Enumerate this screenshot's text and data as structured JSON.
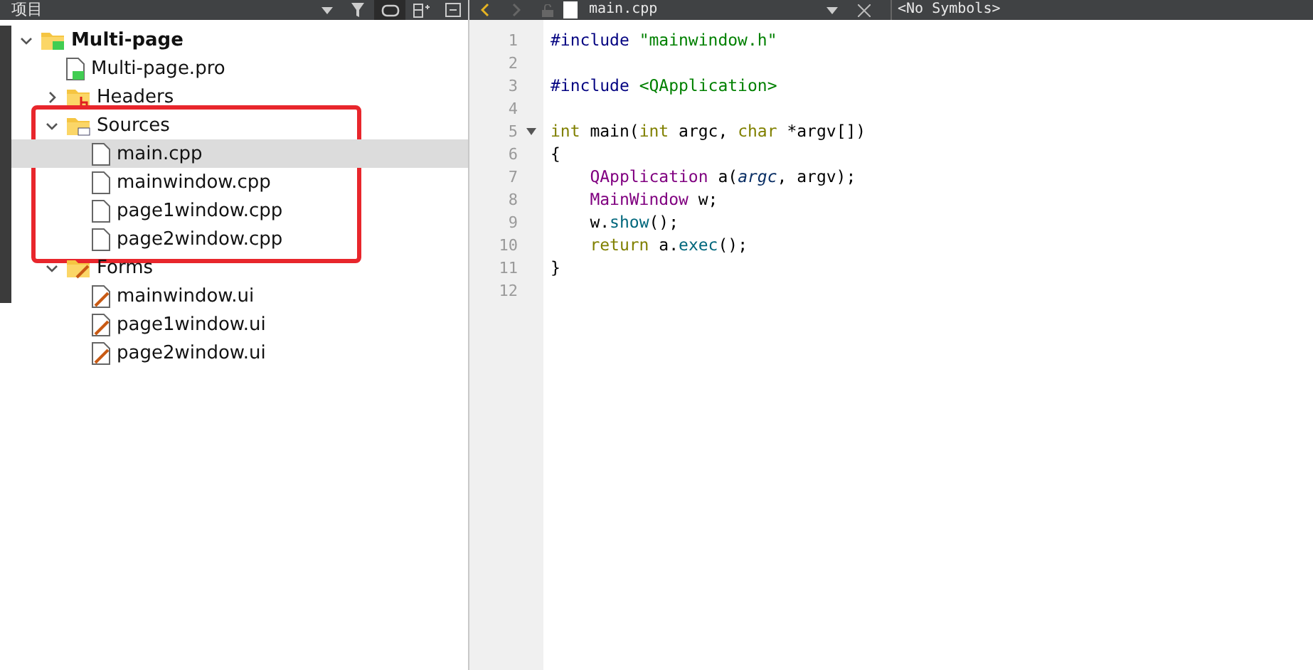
{
  "project_pane": {
    "title": "项目",
    "tree": [
      {
        "label": "Multi-page",
        "kind": "project",
        "expanded": true,
        "selected": false,
        "children": [
          {
            "label": "Multi-page.pro",
            "kind": "pro",
            "selected": false
          },
          {
            "label": "Headers",
            "kind": "folder-h",
            "expanded": false,
            "selected": false
          },
          {
            "label": "Sources",
            "kind": "folder-cpp",
            "expanded": true,
            "selected": false,
            "highlighted": true,
            "children": [
              {
                "label": "main.cpp",
                "kind": "file",
                "selected": true
              },
              {
                "label": "mainwindow.cpp",
                "kind": "file",
                "selected": false
              },
              {
                "label": "page1window.cpp",
                "kind": "file",
                "selected": false
              },
              {
                "label": "page2window.cpp",
                "kind": "file",
                "selected": false
              }
            ]
          },
          {
            "label": "Forms",
            "kind": "folder-forms",
            "expanded": true,
            "selected": false,
            "children": [
              {
                "label": "mainwindow.ui",
                "kind": "ui",
                "selected": false
              },
              {
                "label": "page1window.ui",
                "kind": "ui",
                "selected": false
              },
              {
                "label": "page2window.ui",
                "kind": "ui",
                "selected": false
              }
            ]
          }
        ]
      }
    ]
  },
  "editor": {
    "file_name": "main.cpp",
    "symbols": "<No Symbols>",
    "lines": [
      {
        "number": "1",
        "tokens": [
          {
            "kind": "pre",
            "text": "#include "
          },
          {
            "kind": "str",
            "text": "\"mainwindow.h\""
          }
        ]
      },
      {
        "number": "2"
      },
      {
        "number": "3",
        "tokens": [
          {
            "kind": "pre",
            "text": "#include "
          },
          {
            "kind": "inc",
            "text": "<QApplication>"
          }
        ]
      },
      {
        "number": "4"
      },
      {
        "number": "5",
        "fold": true,
        "tokens": [
          {
            "kind": "kw",
            "text": "int"
          },
          {
            "kind": "plain",
            "text": " main("
          },
          {
            "kind": "kw",
            "text": "int"
          },
          {
            "kind": "plain",
            "text": " argc, "
          },
          {
            "kind": "kw",
            "text": "char"
          },
          {
            "kind": "plain",
            "text": " *argv[])"
          }
        ]
      },
      {
        "number": "6",
        "tokens": [
          {
            "kind": "plain",
            "text": "{"
          }
        ]
      },
      {
        "number": "7",
        "tokens": [
          {
            "kind": "type",
            "text": "    QApplication"
          },
          {
            "kind": "plain",
            "text": " a("
          },
          {
            "kind": "param",
            "text": "argc"
          },
          {
            "kind": "plain",
            "text": ", argv);"
          }
        ]
      },
      {
        "number": "8",
        "tokens": [
          {
            "kind": "type",
            "text": "    MainWindow"
          },
          {
            "kind": "plain",
            "text": " w;"
          }
        ]
      },
      {
        "number": "9",
        "tokens": [
          {
            "kind": "plain",
            "text": "    w."
          },
          {
            "kind": "fn",
            "text": "show"
          },
          {
            "kind": "plain",
            "text": "();"
          }
        ]
      },
      {
        "number": "10",
        "tokens": [
          {
            "kind": "kw",
            "text": "    return"
          },
          {
            "kind": "plain",
            "text": " a."
          },
          {
            "kind": "fn",
            "text": "exec"
          },
          {
            "kind": "plain",
            "text": "();"
          }
        ]
      },
      {
        "number": "11",
        "tokens": [
          {
            "kind": "plain",
            "text": "}"
          }
        ]
      },
      {
        "number": "12"
      }
    ]
  }
}
